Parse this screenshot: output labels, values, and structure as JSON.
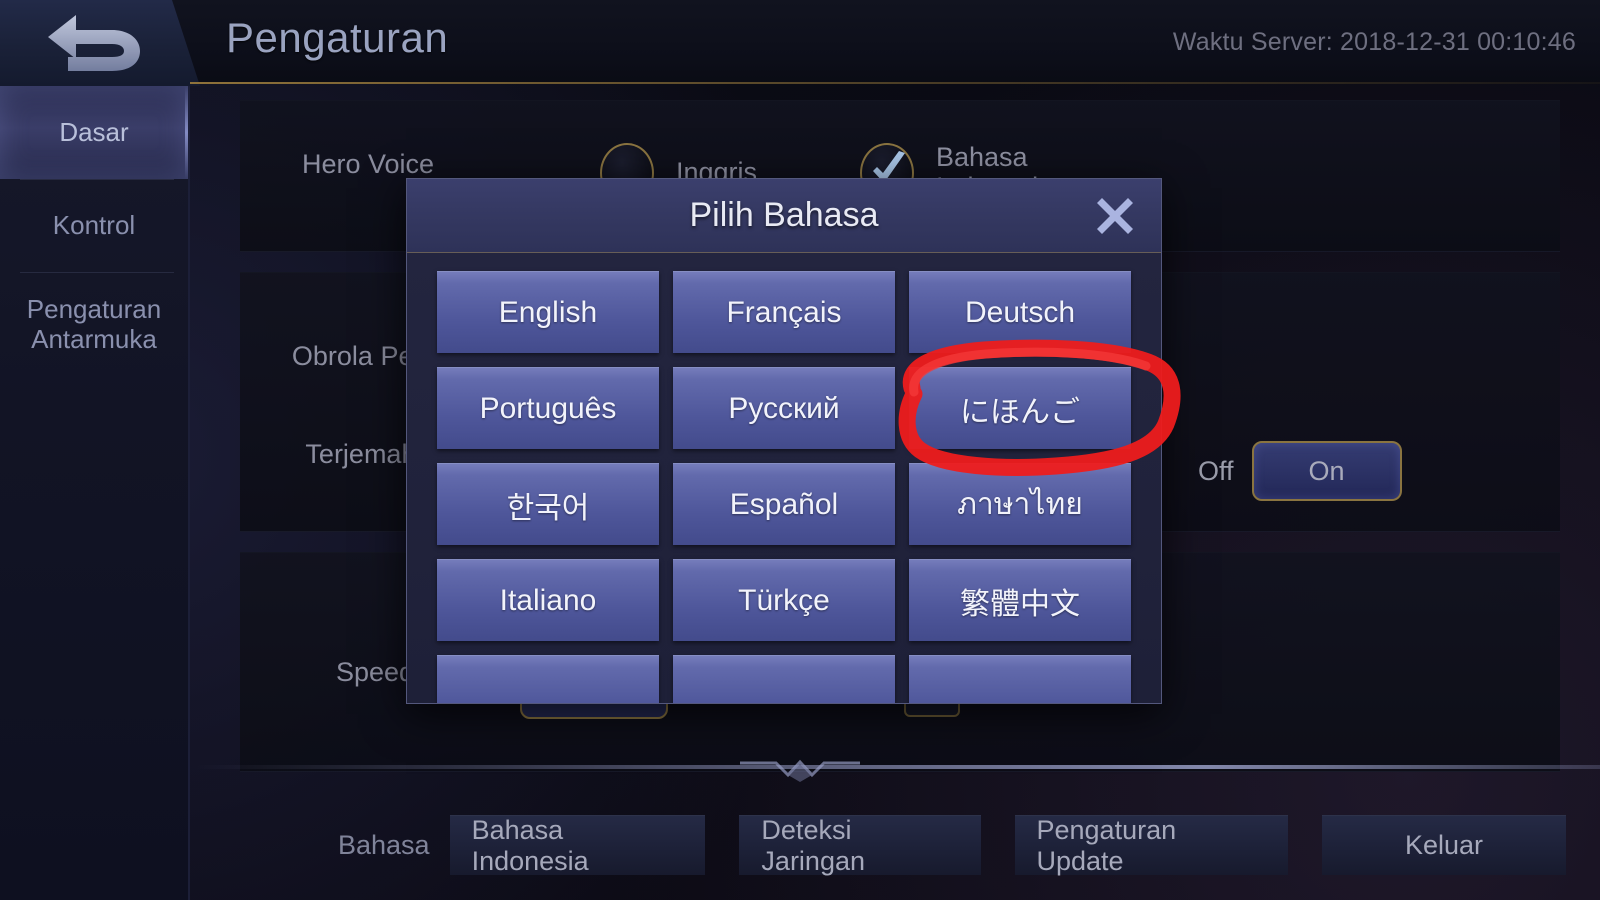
{
  "header": {
    "back_icon": "back-arrow-icon",
    "title": "Pengaturan",
    "server_time": "Waktu Server: 2018-12-31 00:10:46"
  },
  "sidebar": {
    "items": [
      {
        "label": "Dasar",
        "active": true
      },
      {
        "label": "Kontrol",
        "active": false
      },
      {
        "label": "Pengaturan Antarmuka",
        "active": false
      }
    ]
  },
  "settings": {
    "hero_voice": {
      "label": "Hero Voice",
      "options": [
        {
          "label": "Inggris",
          "checked": false
        },
        {
          "label": "Bahasa Indonesia",
          "checked": true
        }
      ]
    },
    "battle_chat": {
      "label_visible": "Obrola Perten"
    },
    "auto_translate": {
      "label_visible": "Terjemaha O"
    },
    "speed": {
      "label_visible": "Speed"
    },
    "toggle": {
      "off_label": "Off",
      "on_label": "On",
      "selected": "On"
    }
  },
  "dialog": {
    "title": "Pilih Bahasa",
    "close_icon": "close-icon",
    "languages": [
      "English",
      "Français",
      "Deutsch",
      "Português",
      "Русский",
      "にほんご",
      "한국어",
      "Español",
      "ภาษาไทย",
      "Italiano",
      "Türkçe",
      "繁體中文"
    ],
    "highlighted_language": "にほんご"
  },
  "bottombar": {
    "label": "Bahasa",
    "buttons": [
      "Bahasa Indonesia",
      "Deteksi Jaringan",
      "Pengaturan Update",
      "Keluar"
    ]
  },
  "colors": {
    "accent_gold": "#8a7440",
    "button_blue": "#4e569a",
    "annotation_red": "#ee1c1c",
    "dialog_header": "#343861"
  }
}
